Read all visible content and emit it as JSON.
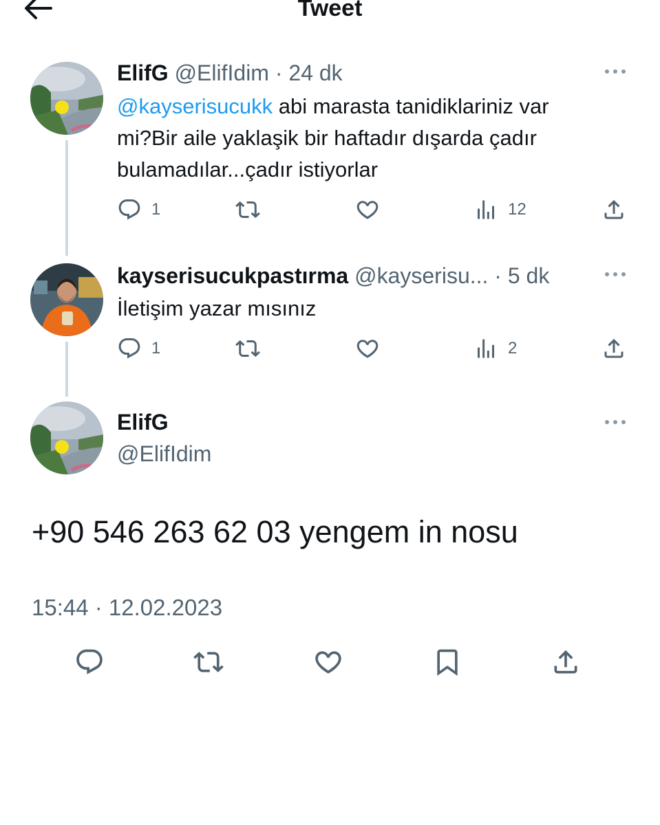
{
  "header": {
    "title": "Tweet"
  },
  "thread": [
    {
      "display_name": "ElifG",
      "handle": "@ElifIdim",
      "time": "· 24 dk",
      "text_mention": "@kayserisucukk",
      "text_line1": " abi marasta tanidiklariniz var",
      "text_line2": "mi?Bir aile yaklaşik bir haftadır  dışarda çadır",
      "text_line3": "bulamadılar...çadır istiyorlar",
      "stats": {
        "replies": "1",
        "views": "12"
      }
    },
    {
      "display_name": "kayserisucukpastırma",
      "handle": "@kayserisu...",
      "time": "· 5 dk",
      "text": "İletişim yazar mısınız",
      "stats": {
        "replies": "1",
        "views": "2"
      }
    }
  ],
  "main_tweet": {
    "display_name": "ElifG",
    "handle": "@ElifIdim",
    "text": "+90 546 263 62 03 yengem in nosu",
    "timestamp": "15:44 · 12.02.2023"
  },
  "icons": [
    "back-arrow-icon",
    "more-icon",
    "reply-icon",
    "retweet-icon",
    "like-icon",
    "views-icon",
    "share-icon",
    "bookmark-icon"
  ],
  "colors": {
    "accent": "#1d9bf0",
    "secondary_text": "#536471",
    "thread_line": "#cfd9de"
  }
}
